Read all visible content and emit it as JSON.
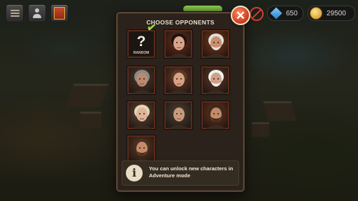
{
  "topbar": {
    "menu_icon": "menu-icon",
    "profile_icon": "profile-icon",
    "book_icon": "book-icon",
    "gems": "650",
    "coins": "29500",
    "colors": {
      "gem": "#2b7fc4",
      "coin": "#c8921e"
    }
  },
  "panel": {
    "title": "CHOOSE OPPONENTS",
    "close_icon": "close-icon",
    "random": {
      "symbol": "?",
      "label": "RANDOM",
      "selected": true
    },
    "opponents": [
      {
        "icon": "portrait-dark-haired-woman",
        "bg": "#6a2e1c"
      },
      {
        "icon": "portrait-bearded-old-man",
        "bg": "#7a3a1c"
      },
      {
        "icon": "portrait-grey-haired-man",
        "bg": "#4a3a30"
      },
      {
        "icon": "portrait-brown-haired-woman",
        "bg": "#6a3a2a"
      },
      {
        "icon": "portrait-white-bearded-elder",
        "bg": "#5a3a2a"
      },
      {
        "icon": "portrait-blonde-woman",
        "bg": "#5a4a3a"
      },
      {
        "icon": "portrait-bald-man",
        "bg": "#4a4238"
      },
      {
        "icon": "portrait-pirate-man",
        "bg": "#6a3520"
      },
      {
        "icon": "portrait-bearded-brute",
        "bg": "#5a3a28"
      }
    ],
    "info": {
      "icon": "info-icon",
      "symbol": "i",
      "text": "You can unlock new characters in Adventure mode"
    }
  }
}
